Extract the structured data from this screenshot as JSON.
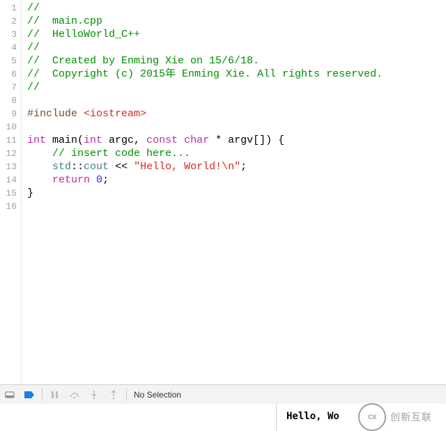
{
  "code": {
    "lines": [
      {
        "n": 1,
        "tokens": [
          {
            "t": "//",
            "c": "c-comment"
          }
        ]
      },
      {
        "n": 2,
        "tokens": [
          {
            "t": "//  main.cpp",
            "c": "c-comment"
          }
        ]
      },
      {
        "n": 3,
        "tokens": [
          {
            "t": "//  HelloWorld_C++",
            "c": "c-comment"
          }
        ]
      },
      {
        "n": 4,
        "tokens": [
          {
            "t": "//",
            "c": "c-comment"
          }
        ]
      },
      {
        "n": 5,
        "tokens": [
          {
            "t": "//  Created by Enming Xie on 15/6/18.",
            "c": "c-comment"
          }
        ]
      },
      {
        "n": 6,
        "tokens": [
          {
            "t": "//  Copyright (c) 2015年 Enming Xie. All rights reserved.",
            "c": "c-comment"
          }
        ]
      },
      {
        "n": 7,
        "tokens": [
          {
            "t": "//",
            "c": "c-comment"
          }
        ]
      },
      {
        "n": 8,
        "tokens": []
      },
      {
        "n": 9,
        "tokens": [
          {
            "t": "#include ",
            "c": "c-preproc"
          },
          {
            "t": "<iostream>",
            "c": "c-sysinc"
          }
        ]
      },
      {
        "n": 10,
        "tokens": []
      },
      {
        "n": 11,
        "tokens": [
          {
            "t": "int",
            "c": "c-keyword"
          },
          {
            "t": " main(",
            "c": ""
          },
          {
            "t": "int",
            "c": "c-keyword"
          },
          {
            "t": " argc, ",
            "c": ""
          },
          {
            "t": "const",
            "c": "c-keyword"
          },
          {
            "t": " ",
            "c": ""
          },
          {
            "t": "char",
            "c": "c-keyword"
          },
          {
            "t": " * argv[]) {",
            "c": ""
          }
        ]
      },
      {
        "n": 12,
        "tokens": [
          {
            "t": "    ",
            "c": ""
          },
          {
            "t": "// insert code here...",
            "c": "c-comment"
          }
        ]
      },
      {
        "n": 13,
        "tokens": [
          {
            "t": "    ",
            "c": ""
          },
          {
            "t": "std",
            "c": "c-ident"
          },
          {
            "t": "::",
            "c": ""
          },
          {
            "t": "cout",
            "c": "c-ident"
          },
          {
            "t": " << ",
            "c": ""
          },
          {
            "t": "\"Hello, World!\\n\"",
            "c": "c-string"
          },
          {
            "t": ";",
            "c": ""
          }
        ]
      },
      {
        "n": 14,
        "tokens": [
          {
            "t": "    ",
            "c": ""
          },
          {
            "t": "return",
            "c": "c-keyword"
          },
          {
            "t": " ",
            "c": ""
          },
          {
            "t": "0",
            "c": "c-number"
          },
          {
            "t": ";",
            "c": ""
          }
        ]
      },
      {
        "n": 15,
        "tokens": [
          {
            "t": "}",
            "c": ""
          }
        ]
      },
      {
        "n": 16,
        "tokens": []
      }
    ]
  },
  "debugbar": {
    "status": "No Selection"
  },
  "output": {
    "text": "Hello, Wo"
  },
  "watermark": {
    "badge": "CX",
    "text": "创新互联"
  }
}
